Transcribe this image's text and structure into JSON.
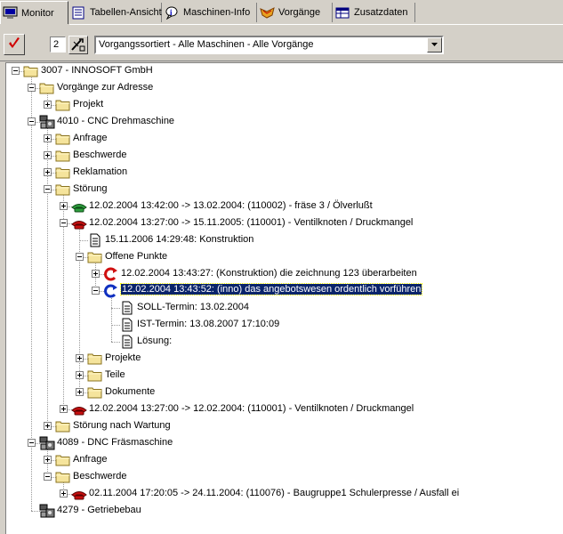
{
  "tabs": [
    {
      "label": "Monitor",
      "icon": "monitor-icon",
      "active": true
    },
    {
      "label": "Tabellen-Ansicht",
      "icon": "table-view-icon",
      "active": false
    },
    {
      "label": "Maschinen-Info",
      "icon": "info-icon",
      "active": false
    },
    {
      "label": "Vorgänge",
      "icon": "processes-icon",
      "active": false
    },
    {
      "label": "Zusatzdaten",
      "icon": "additional-data-icon",
      "active": false
    }
  ],
  "toolbar": {
    "count": "2",
    "sort_select": "Vorgangssortiert - Alle Maschinen - Alle Vorgänge"
  },
  "tree": [
    {
      "level": 0,
      "expander": "minus",
      "icon": "folder",
      "label": "3007 - INNOSOFT GmbH"
    },
    {
      "level": 1,
      "expander": "minus",
      "icon": "folder",
      "label": "Vorgänge zur Adresse"
    },
    {
      "level": 2,
      "expander": "plus",
      "icon": "folder",
      "label": "Projekt"
    },
    {
      "level": 1,
      "expander": "minus",
      "icon": "machine",
      "label": "4010 - CNC Drehmaschine"
    },
    {
      "level": 2,
      "expander": "plus",
      "icon": "folder",
      "label": "Anfrage"
    },
    {
      "level": 2,
      "expander": "plus",
      "icon": "folder",
      "label": "Beschwerde"
    },
    {
      "level": 2,
      "expander": "plus",
      "icon": "folder",
      "label": "Reklamation"
    },
    {
      "level": 2,
      "expander": "minus",
      "icon": "folder",
      "label": "Störung"
    },
    {
      "level": 3,
      "expander": "plus",
      "icon": "phone-green",
      "label": "12.02.2004 13:42:00 -> 13.02.2004: (110002) - fräse 3 / Ölverlußt"
    },
    {
      "level": 3,
      "expander": "minus",
      "icon": "phone-red",
      "label": "12.02.2004 13:27:00 -> 15.11.2005: (110001) - Ventilknoten / Druckmangel"
    },
    {
      "level": 4,
      "expander": "none",
      "icon": "document",
      "label": "15.11.2006 14:29:48: Konstruktion"
    },
    {
      "level": 4,
      "expander": "minus",
      "icon": "folder",
      "label": "Offene Punkte"
    },
    {
      "level": 5,
      "expander": "plus",
      "icon": "refresh-red",
      "label": "12.02.2004 13:43:27: (Konstruktion) die zeichnung 123 überarbeiten"
    },
    {
      "level": 5,
      "expander": "minus",
      "icon": "refresh-blue",
      "label": "12.02.2004 13:43:52: (inno) das angebotswesen ordentlich vorführen",
      "selected": true
    },
    {
      "level": 6,
      "expander": "none",
      "icon": "document",
      "label": "SOLL-Termin: 13.02.2004"
    },
    {
      "level": 6,
      "expander": "none",
      "icon": "document",
      "label": "IST-Termin: 13.08.2007 17:10:09"
    },
    {
      "level": 6,
      "expander": "none",
      "icon": "document",
      "label": "Lösung:"
    },
    {
      "level": 4,
      "expander": "plus",
      "icon": "folder",
      "label": "Projekte"
    },
    {
      "level": 4,
      "expander": "plus",
      "icon": "folder",
      "label": "Teile"
    },
    {
      "level": 4,
      "expander": "plus",
      "icon": "folder",
      "label": "Dokumente"
    },
    {
      "level": 3,
      "expander": "plus",
      "icon": "phone-red",
      "label": "12.02.2004 13:27:00 -> 12.02.2004: (110001) - Ventilknoten / Druckmangel"
    },
    {
      "level": 2,
      "expander": "plus",
      "icon": "folder",
      "label": "Störung nach Wartung"
    },
    {
      "level": 1,
      "expander": "minus",
      "icon": "machine",
      "label": "4089 - DNC Fräsmaschine"
    },
    {
      "level": 2,
      "expander": "plus",
      "icon": "folder",
      "label": "Anfrage"
    },
    {
      "level": 2,
      "expander": "minus",
      "icon": "folder",
      "label": "Beschwerde"
    },
    {
      "level": 3,
      "expander": "plus",
      "icon": "phone-red",
      "label": "02.11.2004 17:20:05 -> 24.11.2004: (110076) - Baugruppe1 Schulerpresse / Ausfall ei"
    },
    {
      "level": 1,
      "expander": "none",
      "icon": "machine",
      "label": "4279 - Getriebebau"
    }
  ],
  "colors": {
    "selection_bg": "#0a246a",
    "folder": "#f5e49c",
    "phone_green": "#2e9e3e",
    "phone_red": "#c81010",
    "check_red": "#d00000"
  }
}
